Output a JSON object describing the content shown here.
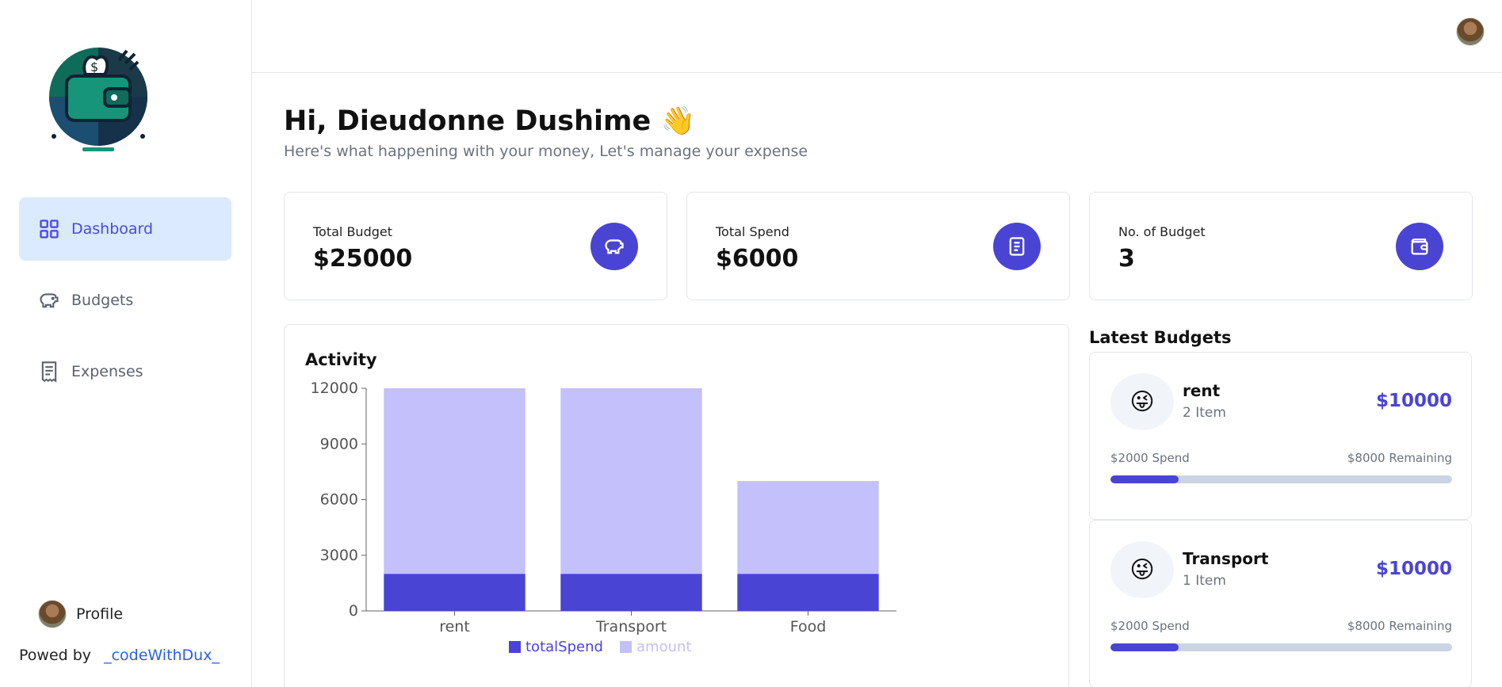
{
  "sidebar": {
    "nav": [
      {
        "label": "Dashboard",
        "icon": "grid-icon",
        "active": true
      },
      {
        "label": "Budgets",
        "icon": "piggy-bank-icon",
        "active": false
      },
      {
        "label": "Expenses",
        "icon": "receipt-icon",
        "active": false
      }
    ],
    "profile_label": "Profile",
    "powered_by": "Powed by",
    "powered_link": "_codeWithDux_"
  },
  "header": {
    "greeting": "Hi, Dieudonne Dushime 👋",
    "subtitle": "Here's what happening with your money, Let's manage your expense"
  },
  "stats": [
    {
      "label": "Total Budget",
      "value": "$25000",
      "icon": "piggy-bank-icon"
    },
    {
      "label": "Total Spend",
      "value": "$6000",
      "icon": "receipt-icon"
    },
    {
      "label": "No. of Budget",
      "value": "3",
      "icon": "wallet-icon"
    }
  ],
  "activity": {
    "title": "Activity"
  },
  "chart_data": {
    "type": "bar",
    "stacked": true,
    "categories": [
      "rent",
      "Transport",
      "Food"
    ],
    "series": [
      {
        "name": "totalSpend",
        "values": [
          2000,
          2000,
          2000
        ],
        "color": "#4a44d4"
      },
      {
        "name": "amount",
        "values": [
          10000,
          10000,
          5000
        ],
        "color": "#c3c0fb"
      }
    ],
    "yticks": [
      0,
      3000,
      6000,
      9000,
      12000
    ],
    "ylim": [
      0,
      12000
    ],
    "legend": "bottom",
    "grid": false
  },
  "latest": {
    "title": "Latest Budgets",
    "budgets": [
      {
        "name": "rent",
        "items": "2 Item",
        "amount": "$10000",
        "spend": "$2000 Spend",
        "remaining": "$8000 Remaining",
        "progress": 0.2,
        "emoji": "😜"
      },
      {
        "name": "Transport",
        "items": "1 Item",
        "amount": "$10000",
        "spend": "$2000 Spend",
        "remaining": "$8000 Remaining",
        "progress": 0.2,
        "emoji": "😜"
      }
    ]
  },
  "colors": {
    "accent": "#4a44d4",
    "accent_light": "#c3c0fb",
    "active_nav_bg": "#dbeafe"
  }
}
